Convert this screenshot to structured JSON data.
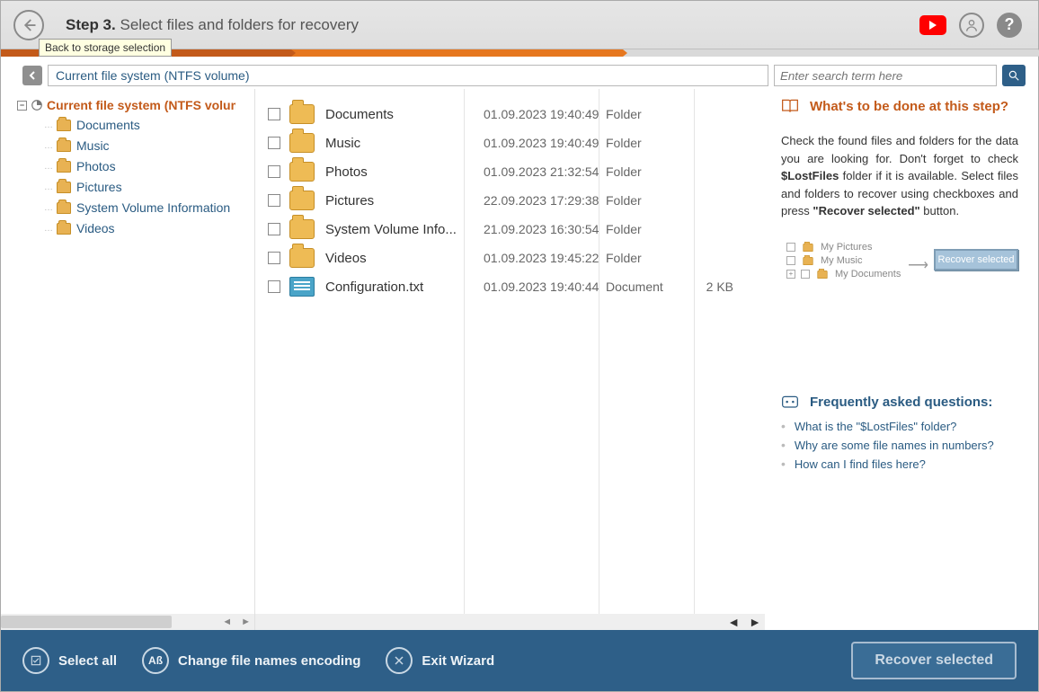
{
  "header": {
    "step_label": "Step 3.",
    "title": "Select files and folders for recovery",
    "tooltip": "Back to storage selection"
  },
  "breadcrumb": {
    "path": "Current file system (NTFS volume)",
    "search_placeholder": "Enter search term here"
  },
  "tree": {
    "root": "Current file system (NTFS volume)",
    "items": [
      "Documents",
      "Music",
      "Photos",
      "Pictures",
      "System Volume Information",
      "Videos"
    ]
  },
  "files": [
    {
      "name": "Documents",
      "date": "01.09.2023 19:40:49",
      "type": "Folder",
      "size": "",
      "kind": "folder"
    },
    {
      "name": "Music",
      "date": "01.09.2023 19:40:49",
      "type": "Folder",
      "size": "",
      "kind": "folder"
    },
    {
      "name": "Photos",
      "date": "01.09.2023 21:32:54",
      "type": "Folder",
      "size": "",
      "kind": "folder"
    },
    {
      "name": "Pictures",
      "date": "22.09.2023 17:29:38",
      "type": "Folder",
      "size": "",
      "kind": "folder"
    },
    {
      "name": "System Volume Info...",
      "date": "21.09.2023 16:30:54",
      "type": "Folder",
      "size": "",
      "kind": "folder"
    },
    {
      "name": "Videos",
      "date": "01.09.2023 19:45:22",
      "type": "Folder",
      "size": "",
      "kind": "folder"
    },
    {
      "name": "Configuration.txt",
      "date": "01.09.2023 19:40:44",
      "type": "Document",
      "size": "2 KB",
      "kind": "file"
    }
  ],
  "info": {
    "heading": "What's to be done at this step?",
    "p1a": "Check the found files and folders for the data you are looking for. Don't forget to check ",
    "p1b": "$LostFiles",
    "p1c": " folder if it is available. Select files and folders to recover using checkboxes and press ",
    "p1d": "\"Recover selected\"",
    "p1e": " button.",
    "illus": {
      "a": "My Pictures",
      "b": "My Music",
      "c": "My Documents",
      "btn": "Recover selected"
    }
  },
  "faq": {
    "heading": "Frequently asked questions:",
    "items": [
      "What is the \"$LostFiles\" folder?",
      "Why are some file names in numbers?",
      "How can I find files here?"
    ]
  },
  "bottom": {
    "select_all": "Select all",
    "encoding": "Change file names encoding",
    "exit": "Exit Wizard",
    "recover": "Recover selected"
  }
}
